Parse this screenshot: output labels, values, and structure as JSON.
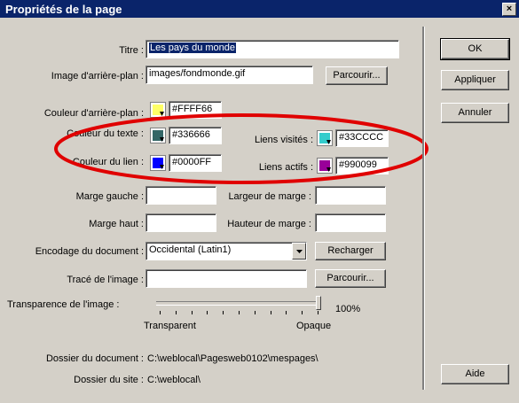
{
  "window": {
    "title": "Propriétés de la page",
    "close": "×"
  },
  "fields": {
    "titre": {
      "label": "Titre :",
      "value": "Les pays du monde"
    },
    "image": {
      "label": "Image d'arrière-plan :",
      "value": "images/fondmonde.gif"
    },
    "bgcolor": {
      "label": "Couleur d'arrière-plan :",
      "value": "#FFFF66",
      "color": "#FFFF66"
    },
    "textcolor": {
      "label": "Couleur du texte :",
      "value": "#336666",
      "color": "#336666"
    },
    "linkcolor": {
      "label": "Couleur du lien :",
      "value": "#0000FF",
      "color": "#0000FF"
    },
    "visited": {
      "label": "Liens visités :",
      "value": "#33CCCC",
      "color": "#33CCCC"
    },
    "active": {
      "label": "Liens actifs :",
      "value": "#990099",
      "color": "#990099"
    },
    "marge_gauche": {
      "label": "Marge gauche :",
      "value": ""
    },
    "largeur_marge": {
      "label": "Largeur de marge :",
      "value": ""
    },
    "marge_haut": {
      "label": "Marge haut :",
      "value": ""
    },
    "hauteur_marge": {
      "label": "Hauteur de marge :",
      "value": ""
    },
    "encodage": {
      "label": "Encodage du document :",
      "value": "Occidental (Latin1)"
    },
    "trace": {
      "label": "Tracé de l'image :",
      "value": ""
    },
    "transparence": {
      "label": "Transparence de l'image :",
      "value": "100%",
      "level": 100,
      "left": "Transparent",
      "right": "Opaque"
    },
    "dossier_doc": {
      "label": "Dossier du document :",
      "value": "C:\\weblocal\\Pagesweb0102\\mespages\\"
    },
    "dossier_site": {
      "label": "Dossier du site :",
      "value": "C:\\weblocal\\"
    }
  },
  "buttons": {
    "ok": "OK",
    "appliquer": "Appliquer",
    "annuler": "Annuler",
    "aide": "Aide",
    "parcourir": "Parcourir...",
    "recharger": "Recharger"
  },
  "annotation": {
    "color": "#e00000"
  }
}
